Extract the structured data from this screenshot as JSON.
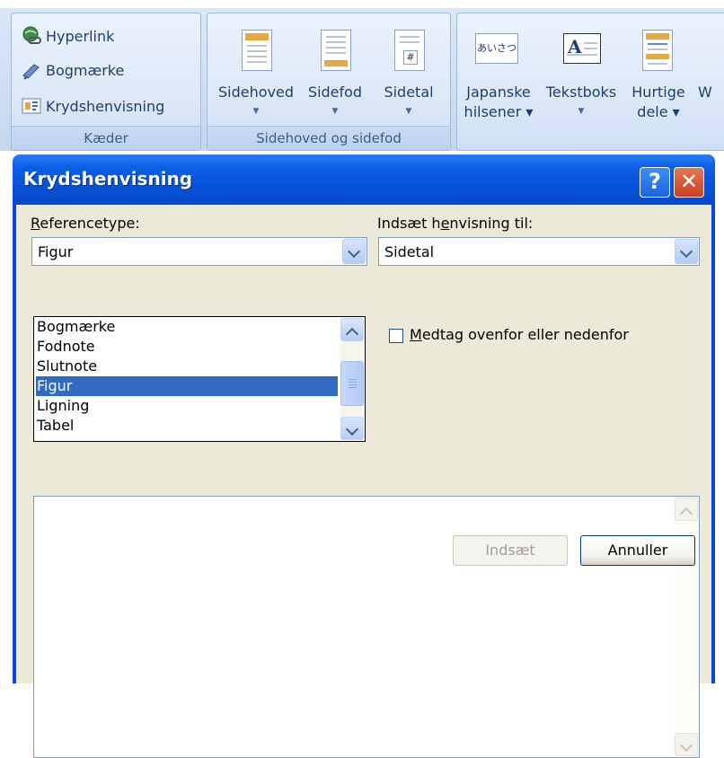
{
  "ribbon": {
    "links_group": {
      "label": "Kæder",
      "items": [
        "Hyperlink",
        "Bogmærke",
        "Krydshenvisning"
      ]
    },
    "header_footer_group": {
      "label": "Sidehoved og sidefod",
      "items": [
        "Sidehoved",
        "Sidefod",
        "Sidetal"
      ]
    },
    "text_group": {
      "japanese_line1": "Japanske",
      "japanese_line2": "hilsener ▾",
      "textbox": "Tekstboks",
      "quickparts_line1": "Hurtige",
      "quickparts_line2": "dele ▾",
      "cut_off": "W",
      "japanese_icon_text": "あいさつ",
      "textbox_icon_text": "A"
    }
  },
  "dialog": {
    "title": "Krydshenvisning",
    "help_glyph": "?",
    "close_glyph": "✕",
    "reference_type_label_ul": "R",
    "reference_type_label_rest": "eferencetype:",
    "reference_type_value": "Figur",
    "reference_type_options": [
      "Bogmærke",
      "Fodnote",
      "Slutnote",
      "Figur",
      "Ligning",
      "Tabel"
    ],
    "selected_option": "Figur",
    "insert_ref_label_a": "Indsæt h",
    "insert_ref_label_ul": "e",
    "insert_ref_label_b": "nvisning til:",
    "insert_ref_value": "Sidetal",
    "include_label_ul": "M",
    "include_label_rest": "edtag ovenfor eller nedenfor",
    "include_checked": false,
    "insert_button": "Indsæt",
    "cancel_button": "Annuller"
  },
  "colors": {
    "titlebar": "#0553d9",
    "selection": "#316ac5",
    "dialog_bg": "#ece9d8"
  }
}
